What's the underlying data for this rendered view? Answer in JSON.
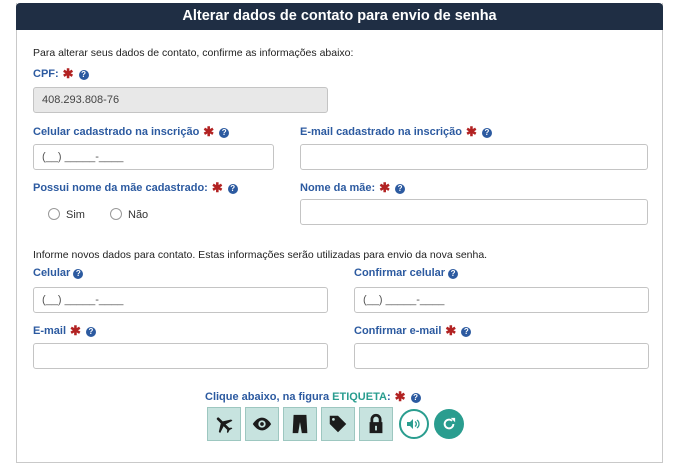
{
  "header": {
    "title": "Alterar dados de contato para envio de senha"
  },
  "intro": "Para alterar seus dados de contato, confirme as informações abaixo:",
  "cpf": {
    "label": "CPF:",
    "value": "408.293.808-76"
  },
  "celular_cadastrado": {
    "label": "Celular cadastrado na inscrição",
    "placeholder": "(__) _____-____"
  },
  "email_cadastrado": {
    "label": "E-mail cadastrado na inscrição",
    "value": ""
  },
  "nome_mae_cadastrado": {
    "label": "Possui nome da mãe cadastrado:",
    "options": [
      "Sim",
      "Não"
    ]
  },
  "nome_mae": {
    "label": "Nome da mãe:",
    "value": ""
  },
  "novos_dados_intro": "Informe novos dados para contato. Estas informações serão utilizadas para envio da nova senha.",
  "celular": {
    "label": "Celular",
    "placeholder": "(__) _____-____"
  },
  "confirmar_celular": {
    "label": "Confirmar celular",
    "placeholder": "(__) _____-____"
  },
  "email": {
    "label": "E-mail",
    "value": ""
  },
  "confirmar_email": {
    "label": "Confirmar e-mail",
    "value": ""
  },
  "captcha": {
    "prompt_prefix": "Clique abaixo, na figura",
    "target": "ETIQUETA",
    "suffix": ":",
    "icons": [
      "airplane-icon",
      "eye-icon",
      "pants-icon",
      "tag-icon",
      "lock-icon"
    ],
    "accent": "#2a9d8f"
  },
  "colors": {
    "header_bg": "#1f2e44",
    "label": "#2c5aa0",
    "required": "#b22222"
  }
}
